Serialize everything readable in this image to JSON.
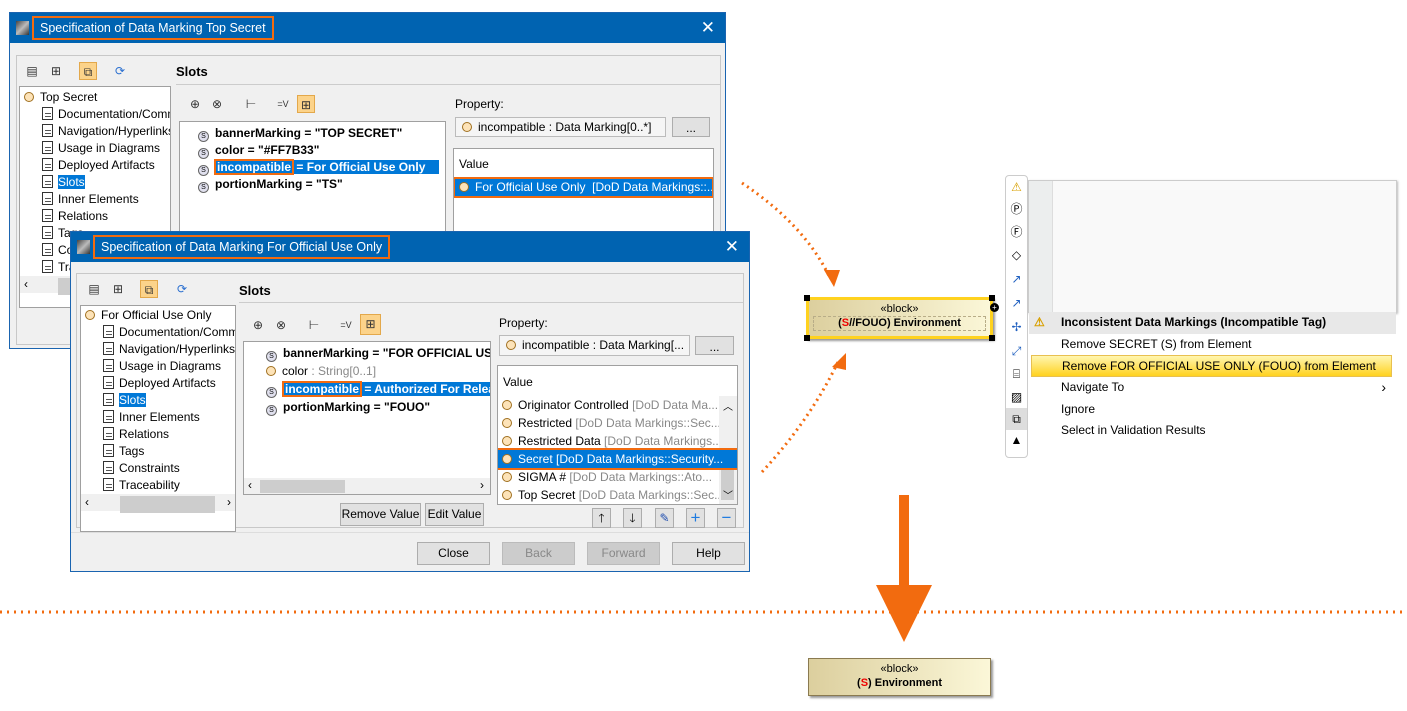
{
  "window1": {
    "title": "Specification of Data Marking Top Secret",
    "section_title": "Slots",
    "tree": [
      "Top Secret",
      "Documentation/Comments",
      "Navigation/Hyperlinks",
      "Usage in Diagrams",
      "Deployed Artifacts",
      "Slots",
      "Inner Elements",
      "Relations",
      "Tags",
      "Constraints",
      "Traceability"
    ],
    "slots": [
      {
        "name": "bannerMarking",
        "value": " = \"TOP SECRET\""
      },
      {
        "name": "color",
        "value": " = \"#FF7B33\""
      },
      {
        "name": "incompatible",
        "value": " = For Official Use Only"
      },
      {
        "name": "portionMarking",
        "value": " = \"TS\""
      }
    ],
    "property_label": "Property:",
    "property_value": "incompatible : Data Marking[0..*]",
    "ellipsis": "...",
    "value_header": "Value",
    "values": [
      {
        "name": "For Official Use Only",
        "qual": "[DoD Data Markings::..."
      }
    ]
  },
  "window2": {
    "title": "Specification of Data Marking For Official Use Only",
    "section_title": "Slots",
    "tree": [
      "For Official Use Only",
      "Documentation/Comments",
      "Navigation/Hyperlinks",
      "Usage in Diagrams",
      "Deployed Artifacts",
      "Slots",
      "Inner Elements",
      "Relations",
      "Tags",
      "Constraints",
      "Traceability"
    ],
    "slots": [
      {
        "name": "bannerMarking",
        "value": " = \"FOR OFFICIAL USE ONLY\""
      },
      {
        "name": "color",
        "value": " : String[0..1]"
      },
      {
        "name": "incompatible",
        "value": " = Authorized For Release"
      },
      {
        "name": "portionMarking",
        "value": " = \"FOUO\""
      }
    ],
    "property_label": "Property:",
    "property_value": "incompatible : Data Marking[...",
    "ellipsis": "...",
    "value_header": "Value",
    "values": [
      {
        "name": "Originator Controlled",
        "qual": "[DoD Data Ma..."
      },
      {
        "name": "Restricted",
        "qual": "[DoD Data Markings::Sec..."
      },
      {
        "name": "Restricted Data",
        "qual": "[DoD Data Markings..."
      },
      {
        "name": "Secret",
        "qual": "[DoD Data Markings::Security..."
      },
      {
        "name": "SIGMA #",
        "qual": "[DoD Data Markings::Ato..."
      },
      {
        "name": "Top Secret",
        "qual": "[DoD Data Markings::Sec..."
      }
    ],
    "remove_value": "Remove Value",
    "edit_value": "Edit Value",
    "close": "Close",
    "back": "Back",
    "forward": "Forward",
    "help": "Help"
  },
  "diagram": {
    "stereotype": "«block»",
    "before_prefix": "(",
    "before_s": "S",
    "before_rest": "//FOUO) Environment",
    "after_prefix": "(",
    "after_s": "S",
    "after_rest": ") Environment"
  },
  "context_menu": {
    "header": "Inconsistent Data Markings (Incompatible Tag)",
    "items": [
      "Remove SECRET (S) from Element",
      "Remove FOR OFFICIAL USE ONLY  (FOUO) from Element",
      "Navigate To",
      "Ignore",
      "Select in Validation Results"
    ]
  },
  "colors": {
    "accent": "#f26b0f",
    "title_bar": "#0063b1",
    "selection": "#0078d7",
    "highlight": "#fdd835"
  }
}
